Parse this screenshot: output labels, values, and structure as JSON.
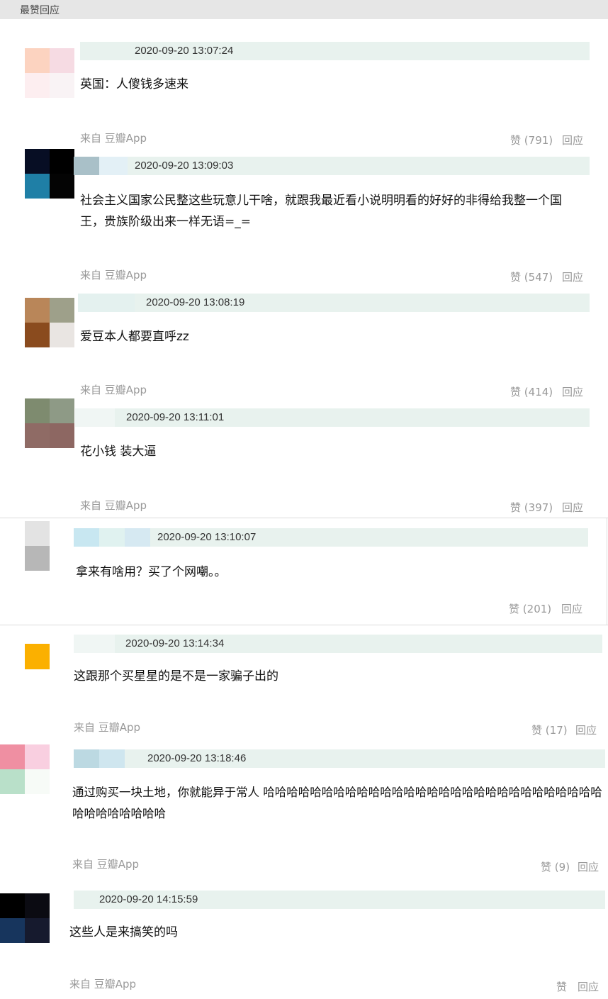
{
  "section_title": "最赞回应",
  "comments": [
    {
      "timestamp": "2020-09-20 13:07:24",
      "text": "英国：人傻钱多速来",
      "source": "来自 豆瓣App",
      "like_label": "赞",
      "like_count": "(791)",
      "reply_label": "回应"
    },
    {
      "timestamp": "2020-09-20 13:09:03",
      "text": "社会主义国家公民整这些玩意儿干啥，就跟我最近看小说明明看的好好的非得给我整一个国\n王，贵族阶级出来一样无语=_=",
      "source": "来自 豆瓣App",
      "like_label": "赞",
      "like_count": "(547)",
      "reply_label": "回应"
    },
    {
      "timestamp": "2020-09-20 13:08:19",
      "text": "爱豆本人都要直呼zz",
      "source": "来自 豆瓣App",
      "like_label": "赞",
      "like_count": "(414)",
      "reply_label": "回应"
    },
    {
      "timestamp": "2020-09-20 13:11:01",
      "text": "花小钱 装大逼",
      "source": "来自 豆瓣App",
      "like_label": "赞",
      "like_count": "(397)",
      "reply_label": "回应"
    },
    {
      "timestamp": "2020-09-20 13:10:07",
      "text": "拿来有啥用？买了个网嘲。。",
      "source": "",
      "like_label": "赞",
      "like_count": "(201)",
      "reply_label": "回应"
    },
    {
      "timestamp": "2020-09-20 13:14:34",
      "text": "这跟那个买星星的是不是一家骗子出的",
      "source": "来自 豆瓣App",
      "like_label": "赞",
      "like_count": "(17)",
      "reply_label": "回应"
    },
    {
      "timestamp": "2020-09-20 13:18:46",
      "text": "通过购买一块土地，你就能异于常人 哈哈哈哈哈哈哈哈哈哈哈哈哈哈哈哈哈哈哈哈哈哈哈哈哈哈哈哈哈\n哈哈哈哈哈哈哈哈",
      "source": "来自 豆瓣App",
      "like_label": "赞",
      "like_count": "(9)",
      "reply_label": "回应"
    },
    {
      "timestamp": "2020-09-20 14:15:59",
      "text": "这些人是来搞笑的吗",
      "source": "来自 豆瓣App",
      "like_label": "赞",
      "like_count": "",
      "reply_label": "回应"
    }
  ],
  "colors": {
    "header_bar": "#e8f2ee",
    "meta_text": "#999999",
    "section_bar": "#e6e6e6"
  }
}
